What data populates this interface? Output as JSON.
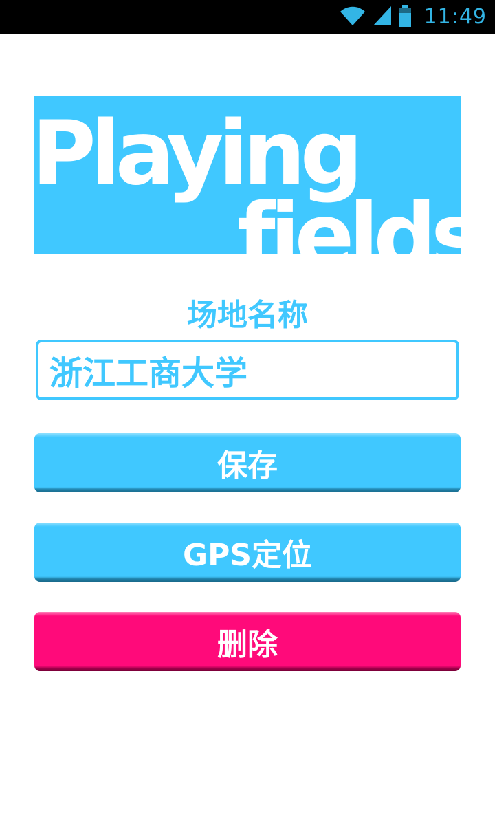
{
  "status_bar": {
    "time": "11:49",
    "icons": [
      "wifi-icon",
      "signal-icon",
      "battery-icon"
    ],
    "icon_color": "#33b5e5"
  },
  "logo": {
    "line1": "Playing",
    "line2": "fields",
    "background": "#40c8ff"
  },
  "form": {
    "label": "场地名称",
    "name_value": "浙江工商大学"
  },
  "buttons": {
    "save_label": "保存",
    "gps_label": "GPS定位",
    "delete_label": "删除"
  },
  "colors": {
    "accent": "#40c8ff",
    "danger": "#ff0a7a"
  }
}
